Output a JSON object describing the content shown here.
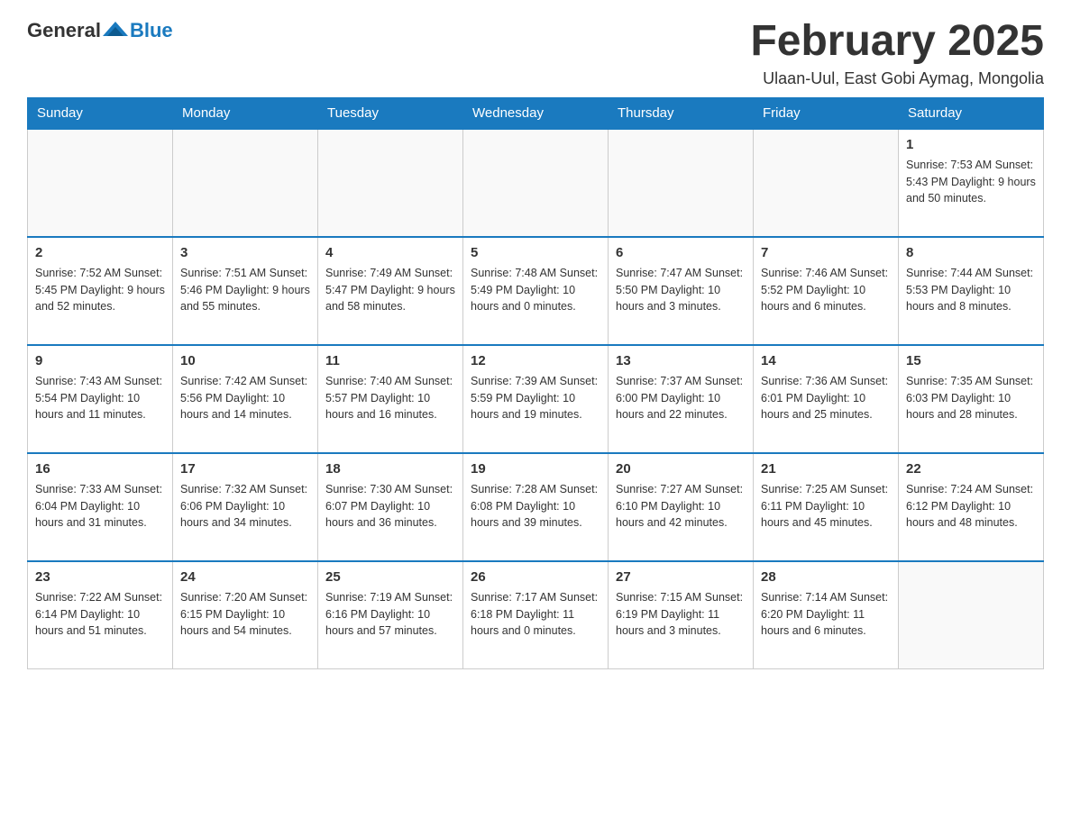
{
  "header": {
    "logo_general": "General",
    "logo_blue": "Blue",
    "month_title": "February 2025",
    "location": "Ulaan-Uul, East Gobi Aymag, Mongolia"
  },
  "days_of_week": [
    "Sunday",
    "Monday",
    "Tuesday",
    "Wednesday",
    "Thursday",
    "Friday",
    "Saturday"
  ],
  "weeks": [
    [
      {
        "day": "",
        "info": ""
      },
      {
        "day": "",
        "info": ""
      },
      {
        "day": "",
        "info": ""
      },
      {
        "day": "",
        "info": ""
      },
      {
        "day": "",
        "info": ""
      },
      {
        "day": "",
        "info": ""
      },
      {
        "day": "1",
        "info": "Sunrise: 7:53 AM\nSunset: 5:43 PM\nDaylight: 9 hours and 50 minutes."
      }
    ],
    [
      {
        "day": "2",
        "info": "Sunrise: 7:52 AM\nSunset: 5:45 PM\nDaylight: 9 hours and 52 minutes."
      },
      {
        "day": "3",
        "info": "Sunrise: 7:51 AM\nSunset: 5:46 PM\nDaylight: 9 hours and 55 minutes."
      },
      {
        "day": "4",
        "info": "Sunrise: 7:49 AM\nSunset: 5:47 PM\nDaylight: 9 hours and 58 minutes."
      },
      {
        "day": "5",
        "info": "Sunrise: 7:48 AM\nSunset: 5:49 PM\nDaylight: 10 hours and 0 minutes."
      },
      {
        "day": "6",
        "info": "Sunrise: 7:47 AM\nSunset: 5:50 PM\nDaylight: 10 hours and 3 minutes."
      },
      {
        "day": "7",
        "info": "Sunrise: 7:46 AM\nSunset: 5:52 PM\nDaylight: 10 hours and 6 minutes."
      },
      {
        "day": "8",
        "info": "Sunrise: 7:44 AM\nSunset: 5:53 PM\nDaylight: 10 hours and 8 minutes."
      }
    ],
    [
      {
        "day": "9",
        "info": "Sunrise: 7:43 AM\nSunset: 5:54 PM\nDaylight: 10 hours and 11 minutes."
      },
      {
        "day": "10",
        "info": "Sunrise: 7:42 AM\nSunset: 5:56 PM\nDaylight: 10 hours and 14 minutes."
      },
      {
        "day": "11",
        "info": "Sunrise: 7:40 AM\nSunset: 5:57 PM\nDaylight: 10 hours and 16 minutes."
      },
      {
        "day": "12",
        "info": "Sunrise: 7:39 AM\nSunset: 5:59 PM\nDaylight: 10 hours and 19 minutes."
      },
      {
        "day": "13",
        "info": "Sunrise: 7:37 AM\nSunset: 6:00 PM\nDaylight: 10 hours and 22 minutes."
      },
      {
        "day": "14",
        "info": "Sunrise: 7:36 AM\nSunset: 6:01 PM\nDaylight: 10 hours and 25 minutes."
      },
      {
        "day": "15",
        "info": "Sunrise: 7:35 AM\nSunset: 6:03 PM\nDaylight: 10 hours and 28 minutes."
      }
    ],
    [
      {
        "day": "16",
        "info": "Sunrise: 7:33 AM\nSunset: 6:04 PM\nDaylight: 10 hours and 31 minutes."
      },
      {
        "day": "17",
        "info": "Sunrise: 7:32 AM\nSunset: 6:06 PM\nDaylight: 10 hours and 34 minutes."
      },
      {
        "day": "18",
        "info": "Sunrise: 7:30 AM\nSunset: 6:07 PM\nDaylight: 10 hours and 36 minutes."
      },
      {
        "day": "19",
        "info": "Sunrise: 7:28 AM\nSunset: 6:08 PM\nDaylight: 10 hours and 39 minutes."
      },
      {
        "day": "20",
        "info": "Sunrise: 7:27 AM\nSunset: 6:10 PM\nDaylight: 10 hours and 42 minutes."
      },
      {
        "day": "21",
        "info": "Sunrise: 7:25 AM\nSunset: 6:11 PM\nDaylight: 10 hours and 45 minutes."
      },
      {
        "day": "22",
        "info": "Sunrise: 7:24 AM\nSunset: 6:12 PM\nDaylight: 10 hours and 48 minutes."
      }
    ],
    [
      {
        "day": "23",
        "info": "Sunrise: 7:22 AM\nSunset: 6:14 PM\nDaylight: 10 hours and 51 minutes."
      },
      {
        "day": "24",
        "info": "Sunrise: 7:20 AM\nSunset: 6:15 PM\nDaylight: 10 hours and 54 minutes."
      },
      {
        "day": "25",
        "info": "Sunrise: 7:19 AM\nSunset: 6:16 PM\nDaylight: 10 hours and 57 minutes."
      },
      {
        "day": "26",
        "info": "Sunrise: 7:17 AM\nSunset: 6:18 PM\nDaylight: 11 hours and 0 minutes."
      },
      {
        "day": "27",
        "info": "Sunrise: 7:15 AM\nSunset: 6:19 PM\nDaylight: 11 hours and 3 minutes."
      },
      {
        "day": "28",
        "info": "Sunrise: 7:14 AM\nSunset: 6:20 PM\nDaylight: 11 hours and 6 minutes."
      },
      {
        "day": "",
        "info": ""
      }
    ]
  ]
}
